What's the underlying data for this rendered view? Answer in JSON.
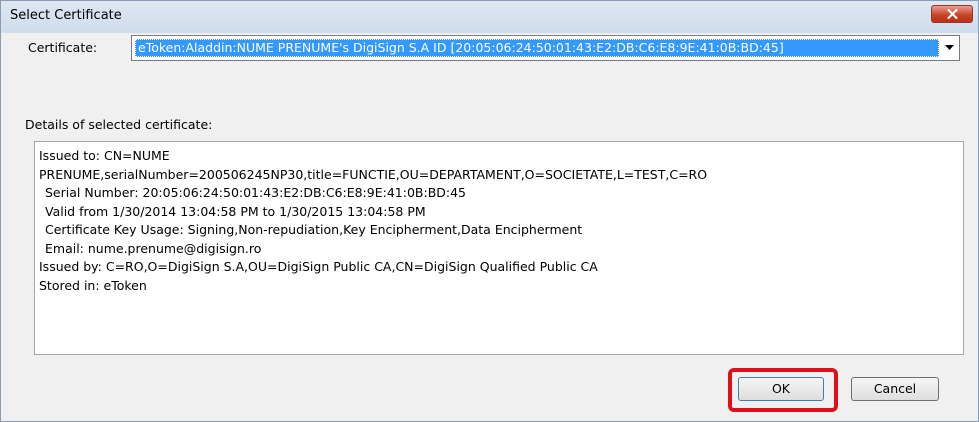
{
  "window": {
    "title": "Select Certificate",
    "close_icon": "close-icon"
  },
  "certificate": {
    "label": "Certificate:",
    "selected_value": "eToken:Aladdin:NUME PRENUME's DigiSign S.A ID [20:05:06:24:50:01:43:E2:DB:C6:E8:9E:41:0B:BD:45]",
    "dropdown_icon": "chevron-down-icon"
  },
  "details": {
    "label": "Details of selected certificate:",
    "lines": [
      "Issued to: CN=NUME",
      "PRENUME,serialNumber=200506245NP30,title=FUNCTIE,OU=DEPARTAMENT,O=SOCIETATE,L=TEST,C=RO",
      "Serial Number: 20:05:06:24:50:01:43:E2:DB:C6:E8:9E:41:0B:BD:45",
      "Valid from 1/30/2014 13:04:58 PM to 1/30/2015 13:04:58 PM",
      "Certificate Key Usage: Signing,Non-repudiation,Key Encipherment,Data Encipherment",
      "Email: nume.prenume@digisign.ro",
      "Issued by: C=RO,O=DigiSign S.A,OU=DigiSign Public CA,CN=DigiSign Qualified Public CA",
      "Stored in: eToken"
    ]
  },
  "buttons": {
    "ok_label": "OK",
    "cancel_label": "Cancel"
  },
  "colors": {
    "selection": "#3399ff",
    "highlight": "#e0101a",
    "close_button": "#c8452a"
  }
}
